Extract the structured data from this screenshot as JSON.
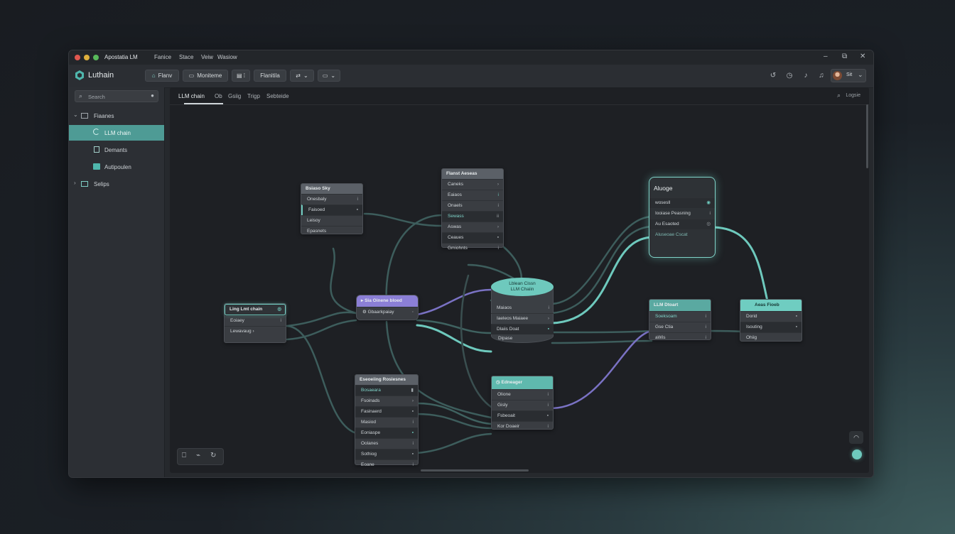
{
  "window": {
    "app_title": "Apostatia LM",
    "menus": [
      "Fanice",
      "Stace",
      "Veiw",
      "Wasiow"
    ],
    "controls": [
      "–",
      "⧉",
      "✕"
    ]
  },
  "toolbar": {
    "brand": "Luthain",
    "buttons": [
      "Flanv",
      "Moniteme",
      "Flanitila"
    ],
    "user_label": "Sit"
  },
  "sidebar": {
    "search_placeholder": "Search",
    "items": [
      {
        "label": "Fiaanes",
        "icon": "folder-icon"
      },
      {
        "label": "LLM chain",
        "icon": "chain-icon"
      },
      {
        "label": "Demants",
        "icon": "document-icon"
      },
      {
        "label": "Autipoulen",
        "icon": "module-icon"
      },
      {
        "label": "Selips",
        "icon": "folder-icon"
      }
    ]
  },
  "tabs": [
    "LLM chain",
    "Ob",
    "Gsiig",
    "Trigp",
    "Sebteide"
  ],
  "tabs_right": "Logsie",
  "nodes": {
    "a": {
      "title": "Bsiaso Sky",
      "rows": [
        "Onesbaly",
        "Faisoed",
        "Leisoy",
        "Epasnets"
      ]
    },
    "b": {
      "title": "Flanst Aeseas",
      "rows": [
        "Caneks",
        "Eaiaos",
        "Onaels",
        "Sewass",
        "Aswas",
        "Ceaues",
        "Gmiohnts"
      ]
    },
    "c": {
      "title": "Aluoge",
      "rows": [
        "wosesll",
        "Iooiase Peasning",
        "Au Esaoted",
        "Aluseoae Cscat"
      ]
    },
    "d": {
      "title": "Ling Lmt chain",
      "rows": [
        "Eoiaey",
        "Lewavaug"
      ]
    },
    "e": {
      "title": "Sia Oinene bloed",
      "rows": [
        "Gbaarkpaiay"
      ]
    },
    "f": {
      "title1": "Lblean Cissn",
      "title2": "LLM Chaiin",
      "rows": [
        "Maiaos",
        "Iaeleos Maiaee",
        "Dlaiis Doat"
      ],
      "footer": "Dipase"
    },
    "g": {
      "title": "LLM Dtoart",
      "rows": [
        "Soeksoam",
        "Gse Ctia",
        "aWis"
      ]
    },
    "h": {
      "title": "Aeas Fioeb",
      "rows": [
        "Dorid",
        "Isouting",
        "Ohiig"
      ]
    },
    "i": {
      "title": "Eseoeiing Rosiesnes",
      "rows": [
        "Bosaeara",
        "Fsoinads",
        "Fasinaerd",
        "Masiod",
        "Eoniaspe",
        "Oolanes",
        "Sothiog",
        "Eoane"
      ]
    },
    "j": {
      "title": "Edneager",
      "rows": [
        "Olione",
        "Gisly",
        "Fsbeoait",
        "Kor Doaeir"
      ]
    }
  },
  "colors": {
    "accent": "#5fc4b8",
    "purple": "#8b7fd6",
    "active_sidebar": "#4e9b95"
  }
}
